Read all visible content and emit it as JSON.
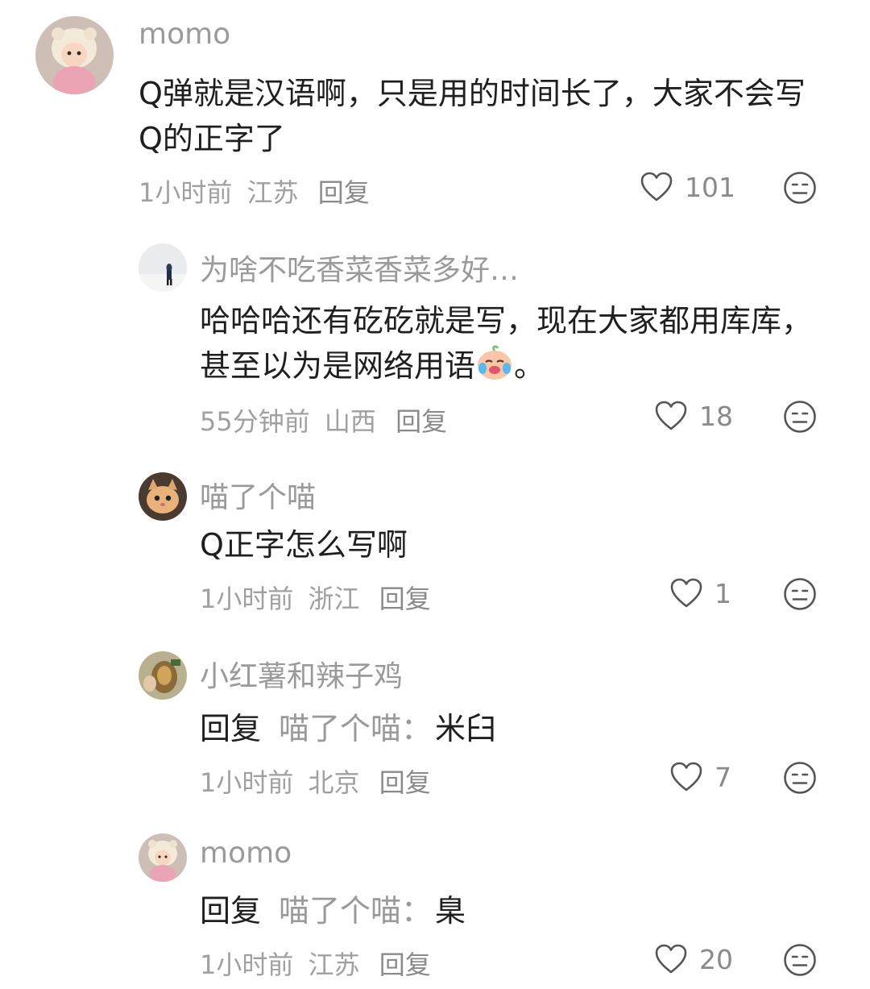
{
  "comments": [
    {
      "username": "momo",
      "content": "Q弹就是汉语啊，只是用的时间长了，大家不会写Q的正字了",
      "time": "1小时前",
      "location": "江苏",
      "reply_label": "回复",
      "likes": "101"
    },
    {
      "username": "为啥不吃香菜香菜多好…",
      "content": "哈哈哈还有矻矻就是写，现在大家都用库库，甚至以为是网络用语",
      "content_suffix": "。",
      "time": "55分钟前",
      "location": "山西",
      "reply_label": "回复",
      "likes": "18"
    },
    {
      "username": "喵了个喵",
      "content": "Q正字怎么写啊",
      "time": "1小时前",
      "location": "浙江",
      "reply_label": "回复",
      "likes": "1"
    },
    {
      "username": "小红薯和辣子鸡",
      "reply_prefix": "回复",
      "reply_target": "喵了个喵：",
      "content": "米臼",
      "time": "1小时前",
      "location": "北京",
      "reply_label": "回复",
      "likes": "7"
    },
    {
      "username": "momo",
      "reply_prefix": "回复",
      "reply_target": "喵了个喵：",
      "content": "臬",
      "time": "1小时前",
      "location": "江苏",
      "reply_label": "回复",
      "likes": "20"
    }
  ],
  "icons": {
    "like": "heart-outline-icon",
    "dislike": "neutral-face-icon",
    "inline_emoji": "crying-laughing-face-emoji"
  },
  "colors": {
    "username": "#9a9a9a",
    "meta": "#a0a0a0",
    "content": "#1f1f1f",
    "icon": "#555555"
  }
}
